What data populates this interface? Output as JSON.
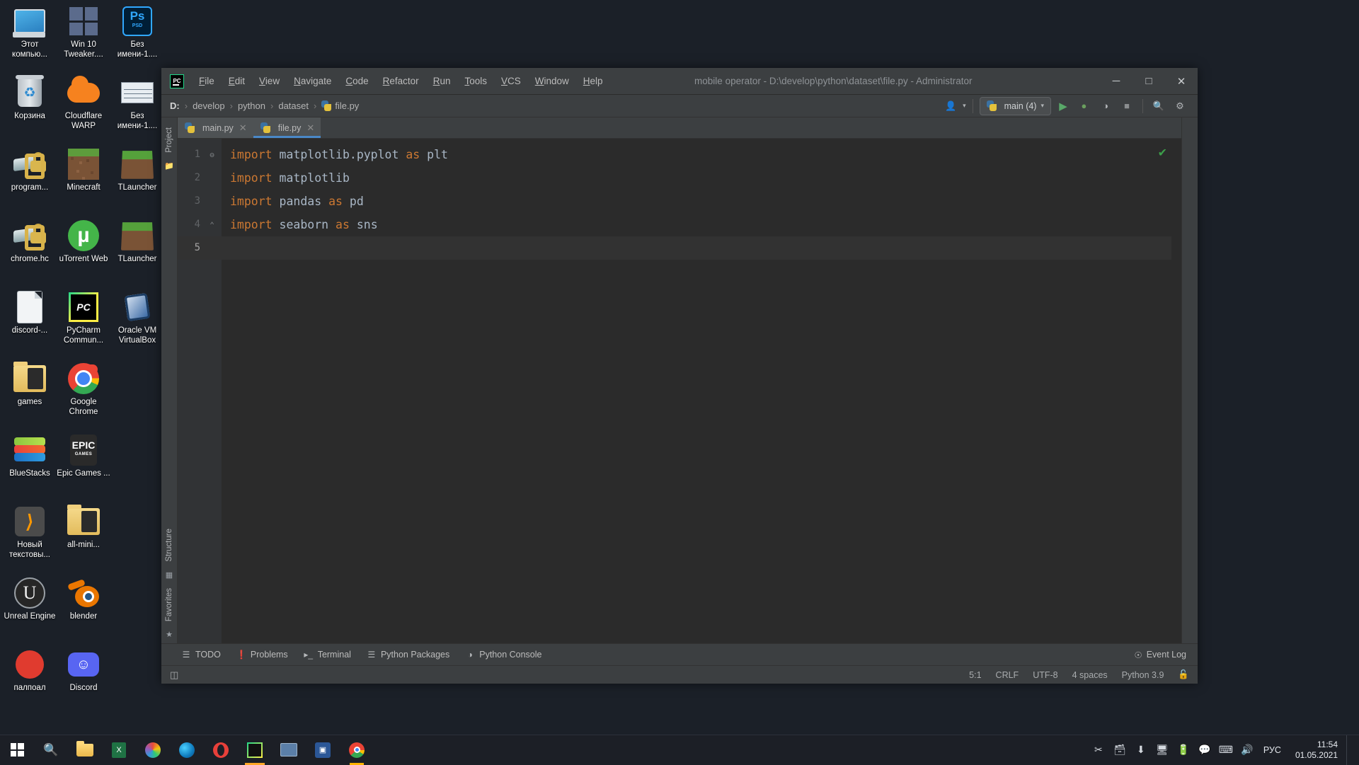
{
  "desktop": {
    "icons": [
      {
        "label": "Этот компью...",
        "icon": "this-pc-icon"
      },
      {
        "label": "Корзина",
        "icon": "recycle-bin-icon"
      },
      {
        "label": "program...",
        "icon": "keyfile-icon"
      },
      {
        "label": "chrome.hc",
        "icon": "keyfile-icon"
      },
      {
        "label": "discord-...",
        "icon": "document-icon"
      },
      {
        "label": "games",
        "icon": "folder-icon"
      },
      {
        "label": "BlueStacks",
        "icon": "bluestacks-icon"
      },
      {
        "label": "Новый текстовы...",
        "icon": "sublime-text-icon"
      },
      {
        "label": "Unreal Engine",
        "icon": "unreal-engine-icon"
      },
      {
        "label": "палпоал",
        "icon": "red-circle-icon"
      },
      {
        "label": "Win 10 Tweaker....",
        "icon": "windows-icon"
      },
      {
        "label": "Cloudflare WARP",
        "icon": "cloudflare-icon"
      },
      {
        "label": "Minecraft",
        "icon": "minecraft-icon"
      },
      {
        "label": "uTorrent Web",
        "icon": "utorrent-icon"
      },
      {
        "label": "PyCharm Commun...",
        "icon": "pycharm-icon"
      },
      {
        "label": "Google Chrome",
        "icon": "chrome-icon"
      },
      {
        "label": "Epic Games ...",
        "icon": "epic-games-icon"
      },
      {
        "label": "all-mini...",
        "icon": "folder-icon"
      },
      {
        "label": "blender",
        "icon": "blender-icon"
      },
      {
        "label": "Discord",
        "icon": "discord-icon"
      },
      {
        "label": "Без имени-1....",
        "icon": "photoshop-psd-icon"
      },
      {
        "label": "Без имени-1....",
        "icon": "screenshot-icon"
      },
      {
        "label": "TLauncher",
        "icon": "minecraft-grass-icon"
      },
      {
        "label": "TLauncher",
        "icon": "minecraft-grass-icon"
      },
      {
        "label": "Oracle VM VirtualBox",
        "icon": "virtualbox-icon"
      }
    ]
  },
  "pycharm": {
    "title": "mobile operator - D:\\develop\\python\\dataset\\file.py - Administrator",
    "menu": [
      "File",
      "Edit",
      "View",
      "Navigate",
      "Code",
      "Refactor",
      "Run",
      "Tools",
      "VCS",
      "Window",
      "Help"
    ],
    "window_controls": {
      "minimize": "─",
      "maximize": "□",
      "close": "✕"
    },
    "breadcrumbs": [
      "D:",
      "develop",
      "python",
      "dataset",
      "file.py"
    ],
    "toolbar": {
      "run_config": "main (4)",
      "run_label": "▶",
      "debug_label": "🐞",
      "coverage_label": "◑",
      "stop_label": "■",
      "search_label": "🔍",
      "settings_label": "⚙",
      "user_label": "👤"
    },
    "left_rail": [
      "Project",
      "Structure",
      "Favorites"
    ],
    "tabs": [
      {
        "label": "main.py",
        "active": false
      },
      {
        "label": "file.py",
        "active": true
      }
    ],
    "editor": {
      "lines": [
        {
          "num": "1",
          "tokens": [
            {
              "t": "import",
              "c": "kw"
            },
            {
              "t": " matplotlib.pyplot ",
              "c": "id"
            },
            {
              "t": "as",
              "c": "kw"
            },
            {
              "t": " plt",
              "c": "id"
            }
          ],
          "fold": "⊖"
        },
        {
          "num": "2",
          "tokens": [
            {
              "t": "import",
              "c": "kw"
            },
            {
              "t": " matplotlib",
              "c": "id"
            }
          ],
          "fold": ""
        },
        {
          "num": "3",
          "tokens": [
            {
              "t": "import",
              "c": "kw"
            },
            {
              "t": " pandas ",
              "c": "id"
            },
            {
              "t": "as",
              "c": "kw"
            },
            {
              "t": " pd",
              "c": "id"
            }
          ],
          "fold": ""
        },
        {
          "num": "4",
          "tokens": [
            {
              "t": "import",
              "c": "kw"
            },
            {
              "t": " seaborn ",
              "c": "id"
            },
            {
              "t": "as",
              "c": "kw"
            },
            {
              "t": " sns",
              "c": "id"
            }
          ],
          "fold": "⌃"
        },
        {
          "num": "5",
          "tokens": [],
          "fold": ""
        }
      ],
      "inspection_status": "✔"
    },
    "tool_windows": [
      {
        "label": "TODO",
        "icon": "list-icon"
      },
      {
        "label": "Problems",
        "icon": "warning-icon"
      },
      {
        "label": "Terminal",
        "icon": "terminal-icon"
      },
      {
        "label": "Python Packages",
        "icon": "packages-icon"
      },
      {
        "label": "Python Console",
        "icon": "python-icon"
      }
    ],
    "event_log": "Event Log",
    "status_bar": {
      "caret": "5:1",
      "line_separator": "CRLF",
      "encoding": "UTF-8",
      "indent": "4 spaces",
      "interpreter": "Python 3.9",
      "lock_icon": "🔓"
    }
  },
  "taskbar": {
    "start": "windows-start-icon",
    "search": "🔍",
    "items": [
      "file-explorer-icon",
      "excel-icon",
      "paint-3d-icon",
      "edge-icon",
      "opera-icon",
      "pycharm-icon",
      "photos-icon",
      "store-icon",
      "chrome-icon"
    ],
    "tray_icons": [
      "✂",
      "🗂",
      "⬇",
      "🖥",
      "🔋",
      "💬",
      "⌨",
      "🔊"
    ],
    "language": "РУС",
    "time": "11:54",
    "date": "01.05.2021"
  },
  "colors": {
    "accent_blue": "#4a88c7",
    "keyword_orange": "#cc7832",
    "identifier": "#a9b7c6",
    "editor_bg": "#2b2b2b",
    "chrome_bg": "#3c3f41",
    "desktop_bg": "#1b2028"
  }
}
